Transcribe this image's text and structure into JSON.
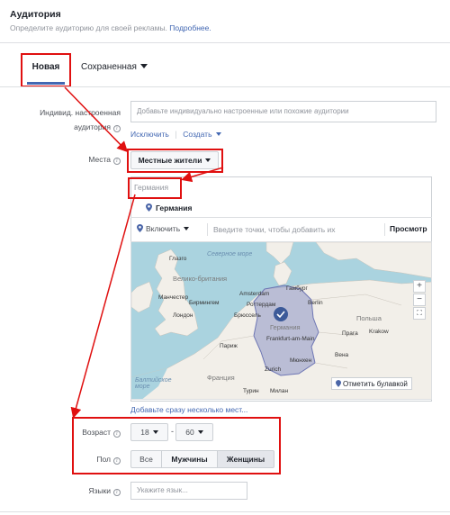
{
  "header": {
    "title": "Аудитория",
    "subtitle": "Определите аудиторию для своей рекламы.",
    "more_link": "Подробнее."
  },
  "tabs": [
    {
      "label": "Новая",
      "active": true
    },
    {
      "label": "Сохраненная",
      "active": false
    }
  ],
  "custom_audience": {
    "label": "Индивид. настроенная аудитория",
    "placeholder": "Добавьте индивидуально настроенные или похожие аудитории",
    "exclude_link": "Исключить",
    "create_link": "Создать"
  },
  "places": {
    "label": "Места",
    "dropdown_value": "Местные жители",
    "filter_text": "Германия",
    "selected_location": "Германия",
    "include_dropdown": "Включить",
    "points_placeholder": "Введите точки, чтобы добавить их",
    "preview_link": "Просмотр",
    "drop_pin_button": "Отметить булавкой",
    "bulk_link": "Добавьте сразу несколько мест..."
  },
  "map": {
    "labels": {
      "north_sea": "Северное море",
      "baltic_sea": "Балтийское море",
      "great_britain": "Велико-британия",
      "germany": "Германия",
      "poland": "Польша",
      "france": "Франция",
      "glasgow": "Глазго",
      "manchester": "Манчестер",
      "birmingham": "Бирмингем",
      "london": "Лондон",
      "amsterdam": "Amsterdam",
      "rotterdam": "Роттердам",
      "brussels": "Брюссель",
      "paris": "Париж",
      "hamburg": "Гамбург",
      "berlin": "Berlin",
      "frankfurt": "Frankfurt-am-Main",
      "munich": "Мюнхен",
      "vienna": "Вена",
      "prague": "Прага",
      "krakow": "Krakow",
      "zurich": "Zurich",
      "turin": "Турин",
      "milan": "Милан"
    },
    "zoom_in": "+",
    "zoom_out": "−"
  },
  "age": {
    "label": "Возраст",
    "min": "18",
    "max": "60",
    "separator": "-"
  },
  "gender": {
    "label": "Пол",
    "options": [
      "Все",
      "Мужчины",
      "Женщины"
    ],
    "selected": "Женщины"
  },
  "languages": {
    "label": "Языки",
    "placeholder": "Укажите язык..."
  },
  "colors": {
    "accent": "#4267b2",
    "highlight": "#e01010",
    "water": "#aad3df",
    "land": "#f2efe9",
    "selection": "#8d93c4"
  }
}
